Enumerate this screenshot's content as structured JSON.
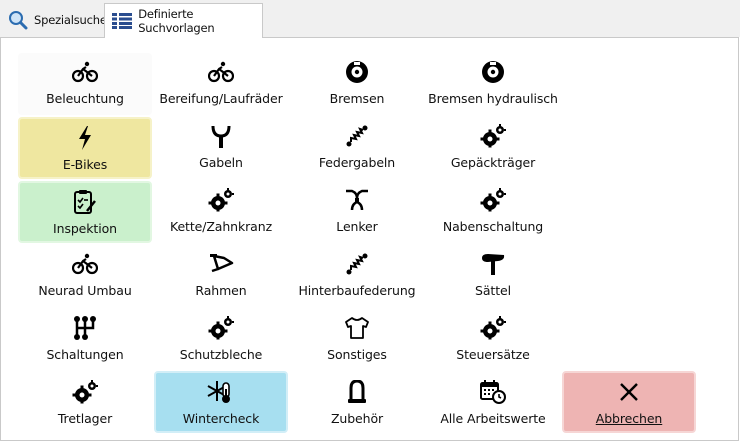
{
  "tabs": [
    {
      "label": "Spezialsuche",
      "icon": "magnifier-icon"
    },
    {
      "label": "Definierte Suchvorlagen",
      "icon": "grid-icon"
    }
  ],
  "tiles": {
    "beleuchtung": {
      "label": "Beleuchtung",
      "icon": "bicycle-icon"
    },
    "bereifung": {
      "label": "Bereifung/Laufräder",
      "icon": "bicycle-icon"
    },
    "bremsen": {
      "label": "Bremsen",
      "icon": "brake-disc-icon"
    },
    "bremsen_hydraulisch": {
      "label": "Bremsen hydraulisch",
      "icon": "brake-disc-icon"
    },
    "ebikes": {
      "label": "E-Bikes",
      "icon": "lightning-icon",
      "color": "#efe7a0"
    },
    "gabeln": {
      "label": "Gabeln",
      "icon": "fork-icon"
    },
    "federgabeln": {
      "label": "Federgabeln",
      "icon": "spring-icon"
    },
    "gepaecktraeger": {
      "label": "Gepäckträger",
      "icon": "gears-icon"
    },
    "inspektion": {
      "label": "Inspektion",
      "icon": "clipboard-check-icon",
      "color": "#caf0cc"
    },
    "kette": {
      "label": "Kette/Zahnkranz",
      "icon": "gears-icon"
    },
    "lenker": {
      "label": "Lenker",
      "icon": "handlebar-icon"
    },
    "nabenschaltung": {
      "label": "Nabenschaltung",
      "icon": "gears-icon"
    },
    "neurad": {
      "label": "Neurad Umbau",
      "icon": "bicycle-icon"
    },
    "rahmen": {
      "label": "Rahmen",
      "icon": "frame-icon"
    },
    "hinterbau": {
      "label": "Hinterbaufederung",
      "icon": "spring-icon"
    },
    "saettel": {
      "label": "Sättel",
      "icon": "saddle-icon"
    },
    "schaltungen": {
      "label": "Schaltungen",
      "icon": "gear-shift-icon"
    },
    "schutzbleche": {
      "label": "Schutzbleche",
      "icon": "gears-icon"
    },
    "sonstiges": {
      "label": "Sonstiges",
      "icon": "shirt-icon"
    },
    "steuersaetze": {
      "label": "Steuersätze",
      "icon": "gears-icon"
    },
    "tretlager": {
      "label": "Tretlager",
      "icon": "gears-icon"
    },
    "wintercheck": {
      "label": "Wintercheck",
      "icon": "snowflake-thermometer-icon",
      "color": "#a7dff0"
    },
    "zubehoer": {
      "label": "Zubehör",
      "icon": "lock-icon"
    },
    "alle": {
      "label": "Alle Arbeitswerte",
      "icon": "calendar-clock-icon"
    },
    "abbrechen": {
      "label": "Abbrechen",
      "icon": "close-icon",
      "color": "#eeb4b3"
    }
  }
}
